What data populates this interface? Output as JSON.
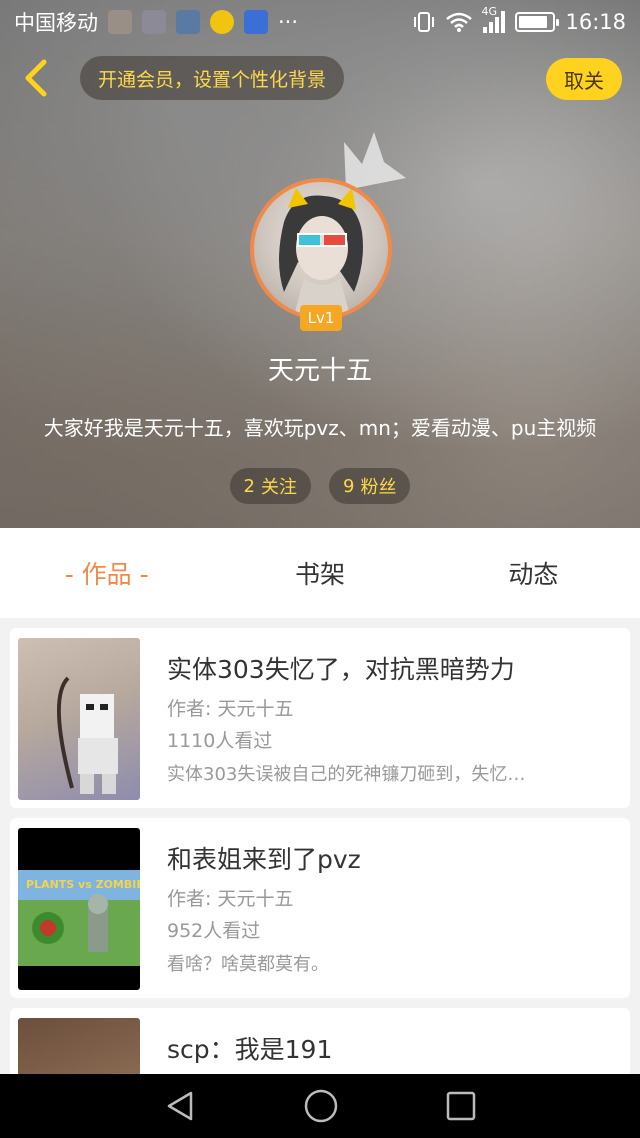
{
  "status_bar": {
    "carrier": "中国移动",
    "more": "···",
    "network": "4G",
    "time": "16:18",
    "battery_level": 0.85
  },
  "header": {
    "vip_banner": "开通会员，设置个性化背景",
    "unfollow_label": "取关"
  },
  "profile": {
    "level": "Lv1",
    "username": "天元十五",
    "bio": "大家好我是天元十五，喜欢玩pvz、mn；爱看动漫、pu主视频",
    "following_count": "2",
    "following_label": "关注",
    "fans_count": "9",
    "fans_label": "粉丝"
  },
  "tabs": [
    {
      "label": "- 作品 -",
      "active": true
    },
    {
      "label": "书架",
      "active": false
    },
    {
      "label": "动态",
      "active": false
    }
  ],
  "works": [
    {
      "title": "实体303失忆了，对抗黑暗势力",
      "author": "作者: 天元十五",
      "views": "1110人看过",
      "desc": "实体303失误被自己的死神镰刀砸到，失忆…"
    },
    {
      "title": "和表姐来到了pvz",
      "author": "作者: 天元十五",
      "views": "952人看过",
      "desc": "看啥？啥莫都莫有。"
    },
    {
      "title": "scp：我是191",
      "author": "",
      "views": "",
      "desc": ""
    }
  ],
  "colors": {
    "accent": "#f08a4b",
    "vip_text": "#ffd84a",
    "unfollow_bg": "#ffd21f"
  }
}
